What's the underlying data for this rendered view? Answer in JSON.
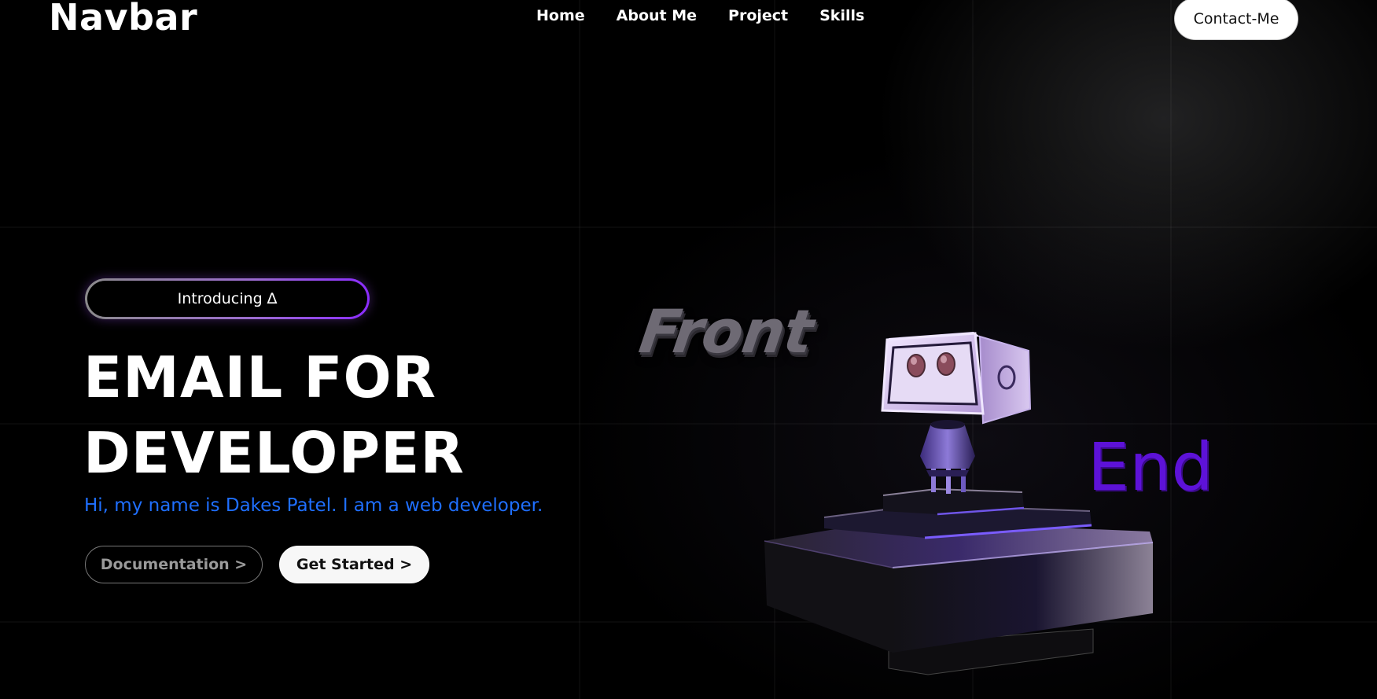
{
  "navbar": {
    "brand": "Navbar",
    "links": [
      "Home",
      "About Me",
      "Project",
      "Skills"
    ],
    "contact_label": "Contact-Me"
  },
  "hero": {
    "intro_pill": "Introducing ∆",
    "headline_line1": "EMAIL FOR",
    "headline_line2": "DEVELOPER",
    "subtitle": "Hi, my name is Dakes Patel. I am a web developer.",
    "doc_button": "Documentation >",
    "start_button": "Get Started >"
  },
  "scene": {
    "front_text": "Front",
    "end_text": "End"
  },
  "colors": {
    "background": "#000000",
    "subtitle_blue": "#1f6fff",
    "accent_purple": "#5d12d8",
    "pill_border_purple": "#8b2cff"
  }
}
